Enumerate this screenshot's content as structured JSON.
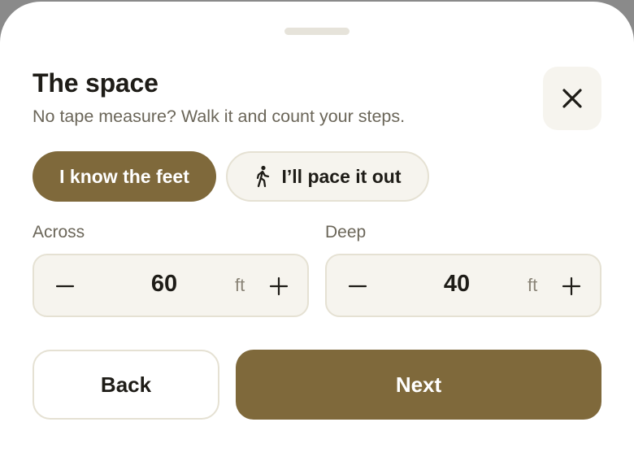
{
  "sheet": {
    "title": "The space",
    "subtitle": "No tape measure? Walk it and count your steps."
  },
  "close_button": {
    "icon": "close-icon"
  },
  "mode_toggle": {
    "options": [
      {
        "label": "I know the feet",
        "selected": true
      },
      {
        "label": "I’ll pace it out",
        "icon": "walking-person-icon",
        "selected": false
      }
    ]
  },
  "dimensions": {
    "across": {
      "label": "Across",
      "value": "60",
      "unit": "ft"
    },
    "deep": {
      "label": "Deep",
      "value": "40",
      "unit": "ft"
    }
  },
  "actions": {
    "back_label": "Back",
    "next_label": "Next"
  },
  "colors": {
    "accent": "#7f693b",
    "surface": "#f6f4ee",
    "border": "#e5e1d3",
    "text_primary": "#1e1c17",
    "text_secondary": "#6b6659"
  }
}
